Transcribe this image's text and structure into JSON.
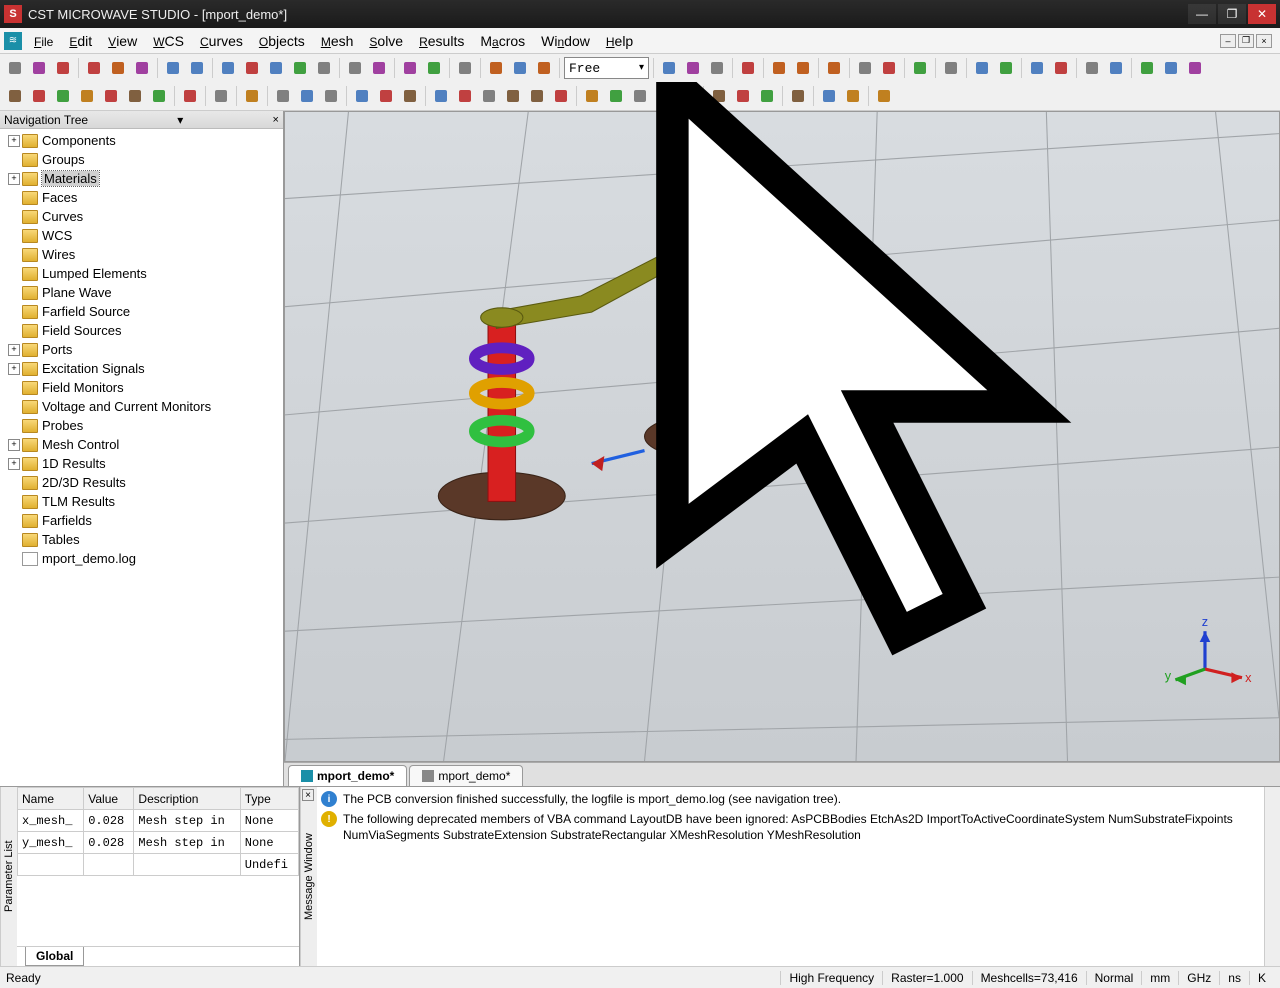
{
  "title": "CST MICROWAVE STUDIO - [mport_demo*]",
  "menus": [
    "File",
    "Edit",
    "View",
    "WCS",
    "Curves",
    "Objects",
    "Mesh",
    "Solve",
    "Results",
    "Macros",
    "Window",
    "Help"
  ],
  "toolbar_combo": "Free",
  "nav": {
    "header": "Navigation Tree",
    "items": [
      {
        "label": "Components",
        "exp": true,
        "folder": true
      },
      {
        "label": "Groups",
        "exp": false,
        "folder": true
      },
      {
        "label": "Materials",
        "exp": true,
        "folder": true,
        "selected": true
      },
      {
        "label": "Faces",
        "exp": false,
        "folder": true
      },
      {
        "label": "Curves",
        "exp": false,
        "folder": true
      },
      {
        "label": "WCS",
        "exp": false,
        "folder": true
      },
      {
        "label": "Wires",
        "exp": false,
        "folder": true
      },
      {
        "label": "Lumped Elements",
        "exp": false,
        "folder": true
      },
      {
        "label": "Plane Wave",
        "exp": false,
        "folder": true
      },
      {
        "label": "Farfield Source",
        "exp": false,
        "folder": true
      },
      {
        "label": "Field Sources",
        "exp": false,
        "folder": true
      },
      {
        "label": "Ports",
        "exp": true,
        "folder": true
      },
      {
        "label": "Excitation Signals",
        "exp": true,
        "folder": true
      },
      {
        "label": "Field Monitors",
        "exp": false,
        "folder": true
      },
      {
        "label": "Voltage and Current Monitors",
        "exp": false,
        "folder": true
      },
      {
        "label": "Probes",
        "exp": false,
        "folder": true
      },
      {
        "label": "Mesh Control",
        "exp": true,
        "folder": true
      },
      {
        "label": "1D Results",
        "exp": true,
        "folder": true
      },
      {
        "label": "2D/3D Results",
        "exp": false,
        "folder": true
      },
      {
        "label": "TLM Results",
        "exp": false,
        "folder": true
      },
      {
        "label": "Farfields",
        "exp": false,
        "folder": true
      },
      {
        "label": "Tables",
        "exp": false,
        "folder": true
      },
      {
        "label": "mport_demo.log",
        "exp": false,
        "folder": false
      }
    ]
  },
  "doc_tabs": [
    {
      "label": "mport_demo*",
      "active": true
    },
    {
      "label": "mport_demo*",
      "active": false
    }
  ],
  "axes": {
    "x": "x",
    "y": "y",
    "z": "z"
  },
  "param": {
    "side_label": "Parameter List",
    "headers": [
      "Name",
      "Value",
      "Description",
      "Type"
    ],
    "rows": [
      {
        "name": "x_mesh_",
        "value": "0.028",
        "desc": "Mesh step in",
        "type": "None"
      },
      {
        "name": "y_mesh_",
        "value": "0.028",
        "desc": "Mesh step in",
        "type": "None"
      },
      {
        "name": "",
        "value": "",
        "desc": "",
        "type": "Undefi"
      }
    ],
    "tab": "Global"
  },
  "messages": {
    "side_label": "Message Window",
    "items": [
      {
        "kind": "info",
        "text": "The PCB conversion finished successfully, the logfile is mport_demo.log (see navigation tree)."
      },
      {
        "kind": "warn",
        "text": "The following deprecated members of VBA command LayoutDB have been ignored: AsPCBBodies EtchAs2D ImportToActiveCoordinateSystem NumSubstrateFixpoints NumViaSegments SubstrateExtension SubstrateRectangular XMeshResolution YMeshResolution"
      }
    ]
  },
  "status": {
    "ready": "Ready",
    "mode": "High Frequency",
    "raster": "Raster=1.000",
    "meshcells": "Meshcells=73,416",
    "normal": "Normal",
    "unit1": "mm",
    "unit2": "GHz",
    "unit3": "ns",
    "unit4": "K"
  }
}
